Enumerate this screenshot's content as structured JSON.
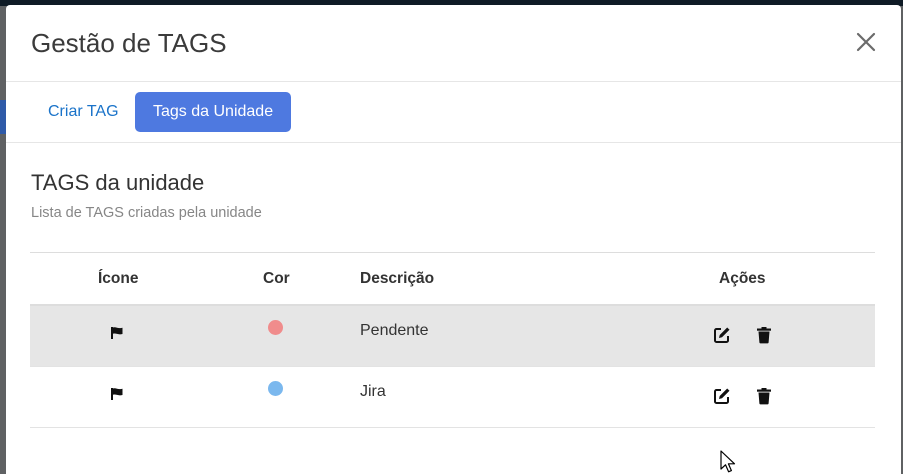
{
  "modal": {
    "title": "Gestão de TAGS",
    "close_icon": "close-icon"
  },
  "tabs": [
    {
      "label": "Criar TAG",
      "active": false
    },
    {
      "label": "Tags da Unidade",
      "active": true
    }
  ],
  "section": {
    "title": "TAGS da unidade",
    "subtitle": "Lista de TAGS criadas pela unidade"
  },
  "table": {
    "headers": {
      "icon": "Ícone",
      "color": "Cor",
      "description": "Descrição",
      "actions": "Ações"
    },
    "rows": [
      {
        "icon": "flag-icon",
        "color": "#f08c8c",
        "description": "Pendente",
        "edit_icon": "edit-icon",
        "delete_icon": "trash-icon"
      },
      {
        "icon": "flag-icon",
        "color": "#7bb8ee",
        "description": "Jira",
        "edit_icon": "edit-icon",
        "delete_icon": "trash-icon"
      }
    ]
  },
  "colors": {
    "accent": "#4e79e0",
    "link": "#1a73c9",
    "row_highlight": "#e6e6e6"
  }
}
